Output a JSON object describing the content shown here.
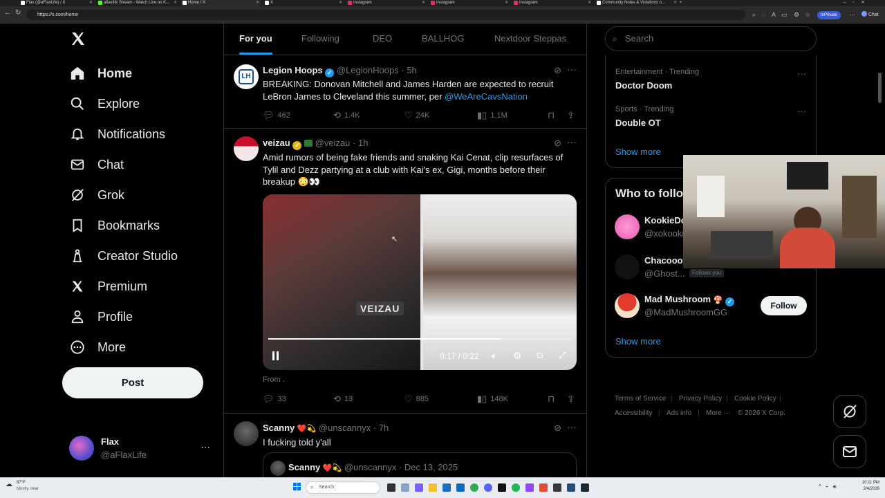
{
  "browser": {
    "tabs": [
      {
        "label": "Flax (@aFlaxLife) / X"
      },
      {
        "label": "aflaxlife Stream - Watch Live on K..."
      },
      {
        "label": "Home / X"
      },
      {
        "label": "X"
      },
      {
        "label": "Instagram"
      },
      {
        "label": "Instagram"
      },
      {
        "label": "Instagram"
      },
      {
        "label": "Community Notes & Violations o..."
      }
    ],
    "url": "https://x.com/home",
    "inprivate_label": "InPrivate",
    "chat_label": "Chat"
  },
  "nav": {
    "logo": "x-logo",
    "items": [
      {
        "label": "Home",
        "icon": "home-icon"
      },
      {
        "label": "Explore",
        "icon": "search-icon"
      },
      {
        "label": "Notifications",
        "icon": "bell-icon"
      },
      {
        "label": "Chat",
        "icon": "mail-icon"
      },
      {
        "label": "Grok",
        "icon": "grok-icon"
      },
      {
        "label": "Bookmarks",
        "icon": "bookmark-icon"
      },
      {
        "label": "Creator Studio",
        "icon": "creator-studio-icon"
      },
      {
        "label": "Premium",
        "icon": "x-logo-icon"
      },
      {
        "label": "Profile",
        "icon": "person-icon"
      },
      {
        "label": "More",
        "icon": "more-circle-icon"
      }
    ],
    "post_label": "Post",
    "account": {
      "name": "Flax",
      "handle": "@aFlaxLife"
    }
  },
  "feed": {
    "tabs": [
      "For you",
      "Following",
      "DEO",
      "BALLHOG",
      "Nextdoor Steppas"
    ],
    "active_tab": "For you",
    "tweets": [
      {
        "name": "Legion Hoops",
        "handle": "@LegionHoops",
        "time": "· 5h",
        "text": "BREAKING: Donovan Mitchell and James Harden are expected to recruit LeBron James to Cleveland this summer, per",
        "mention": "@WeAreCavsNation",
        "replies": "462",
        "reposts": "1.4K",
        "likes": "24K",
        "views": "1.1M"
      },
      {
        "name": "veizau",
        "handle": "@veizau",
        "time": "· 1h",
        "text": "Amid rumors of being fake friends and snaking Kai Cenat, clip resurfaces of Tylil and Dezz partying at a club with Kai's ex, Gigi, months before their breakup 😳👀",
        "video_time": "0:17 / 0:22",
        "video_progress": 0.77,
        "watermark": "VEIZAU",
        "from_label": "From .",
        "replies": "33",
        "reposts": "13",
        "likes": "885",
        "views": "148K"
      },
      {
        "name": "Scanny",
        "handle": "@unscannyx",
        "time": "· 7h",
        "text": "I fucking told y'all",
        "quote": {
          "name": "Scanny",
          "handle": "@unscannyx",
          "time": "· Dec 13, 2025"
        }
      }
    ]
  },
  "sidebar": {
    "search_placeholder": "Search",
    "trends": [
      {
        "category": "Entertainment · Trending",
        "name": "Doctor Doom"
      },
      {
        "category": "Sports · Trending",
        "name": "Double OT"
      }
    ],
    "show_more": "Show more",
    "who_to_follow_title": "Who to follow",
    "suggestions": [
      {
        "name": "KookieDo",
        "handle": "@xokookie"
      },
      {
        "name": "Chacooo",
        "handle": "@Ghost...",
        "badge": "Follows you"
      },
      {
        "name": "Mad Mushroom",
        "handle": "@MadMushroomGG",
        "button": "Follow"
      }
    ],
    "footer": [
      "Terms of Service",
      "Privacy Policy",
      "Cookie Policy",
      "Accessibility",
      "Ads info",
      "More ···",
      "© 2026 X Corp."
    ]
  },
  "taskbar": {
    "weather_temp": "67°F",
    "weather_desc": "Mostly clear",
    "search_label": "Search",
    "time": "10:11 PM",
    "date": "2/4/2026"
  },
  "colors": {
    "accent": "#1d9bf0",
    "background": "#000000",
    "border": "#2f3336",
    "muted": "#71767b"
  }
}
